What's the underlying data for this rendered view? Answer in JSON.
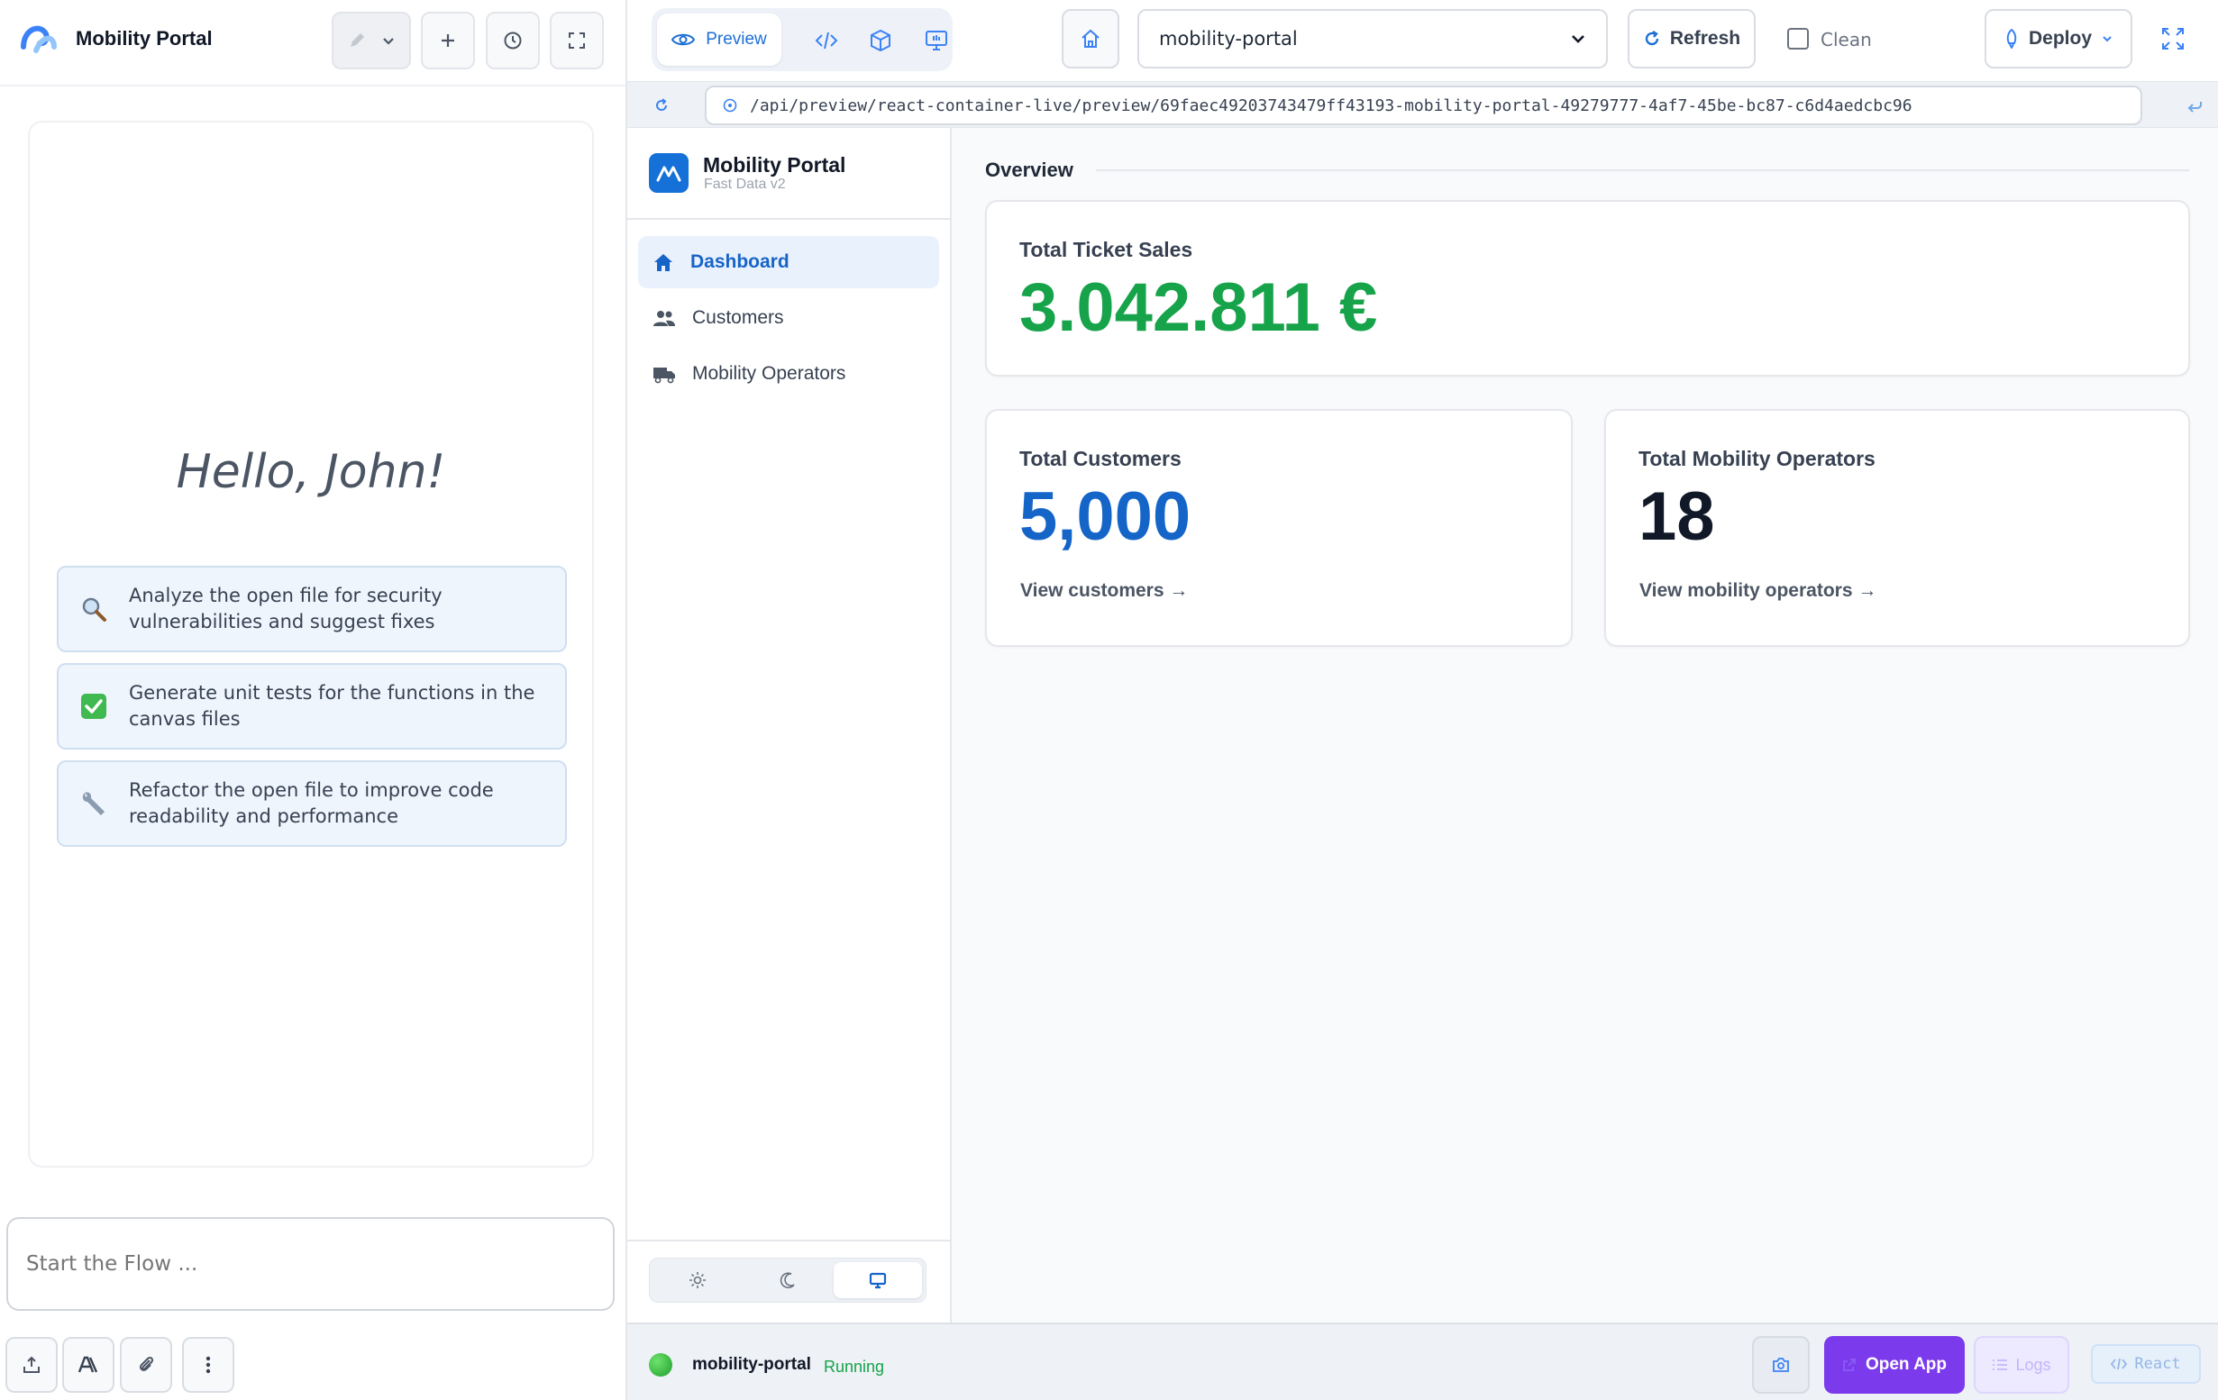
{
  "colors": {
    "accent": "#1570d8",
    "sales_green": "#16a34a",
    "customers_blue": "#1565c8",
    "open_app_purple": "#7c3aed",
    "running_green": "#15a34a"
  },
  "left_panel": {
    "title": "Mobility Portal",
    "greeting": "Hello, John!",
    "suggestions": [
      {
        "icon": "magnifier-icon",
        "text": "Analyze the open file for security vulnerabilities and suggest fixes"
      },
      {
        "icon": "checkmark-icon",
        "text": "Generate unit tests for the functions in the canvas files"
      },
      {
        "icon": "wrench-icon",
        "text": "Refactor the open file to improve code readability and performance"
      }
    ],
    "input_placeholder": "Start the Flow ..."
  },
  "toolbar": {
    "preview_label": "Preview",
    "project": "mobility-portal",
    "refresh_label": "Refresh",
    "clean_label": "Clean",
    "deploy_label": "Deploy"
  },
  "address": {
    "url": "/api/preview/react-container-live/preview/69faec49203743479ff43193-mobility-portal-49279777-4af7-45be-bc87-c6d4aedcbc96"
  },
  "app": {
    "brand_name": "Mobility Portal",
    "brand_sub": "Fast Data v2",
    "nav": [
      {
        "label": "Dashboard",
        "icon": "home-icon",
        "active": true
      },
      {
        "label": "Customers",
        "icon": "users-icon",
        "active": false
      },
      {
        "label": "Mobility Operators",
        "icon": "truck-icon",
        "active": false
      }
    ],
    "overview_title": "Overview",
    "sales": {
      "label": "Total Ticket Sales",
      "value": "3.042.811 €"
    },
    "customers": {
      "label": "Total Customers",
      "value": "5,000",
      "link": "View customers →"
    },
    "operators": {
      "label": "Total Mobility Operators",
      "value": "18",
      "link": "View mobility operators →"
    }
  },
  "status_bar": {
    "name": "mobility-portal",
    "state": "Running",
    "open_app_label": "Open App",
    "logs_label": "Logs",
    "react_label": "React"
  }
}
